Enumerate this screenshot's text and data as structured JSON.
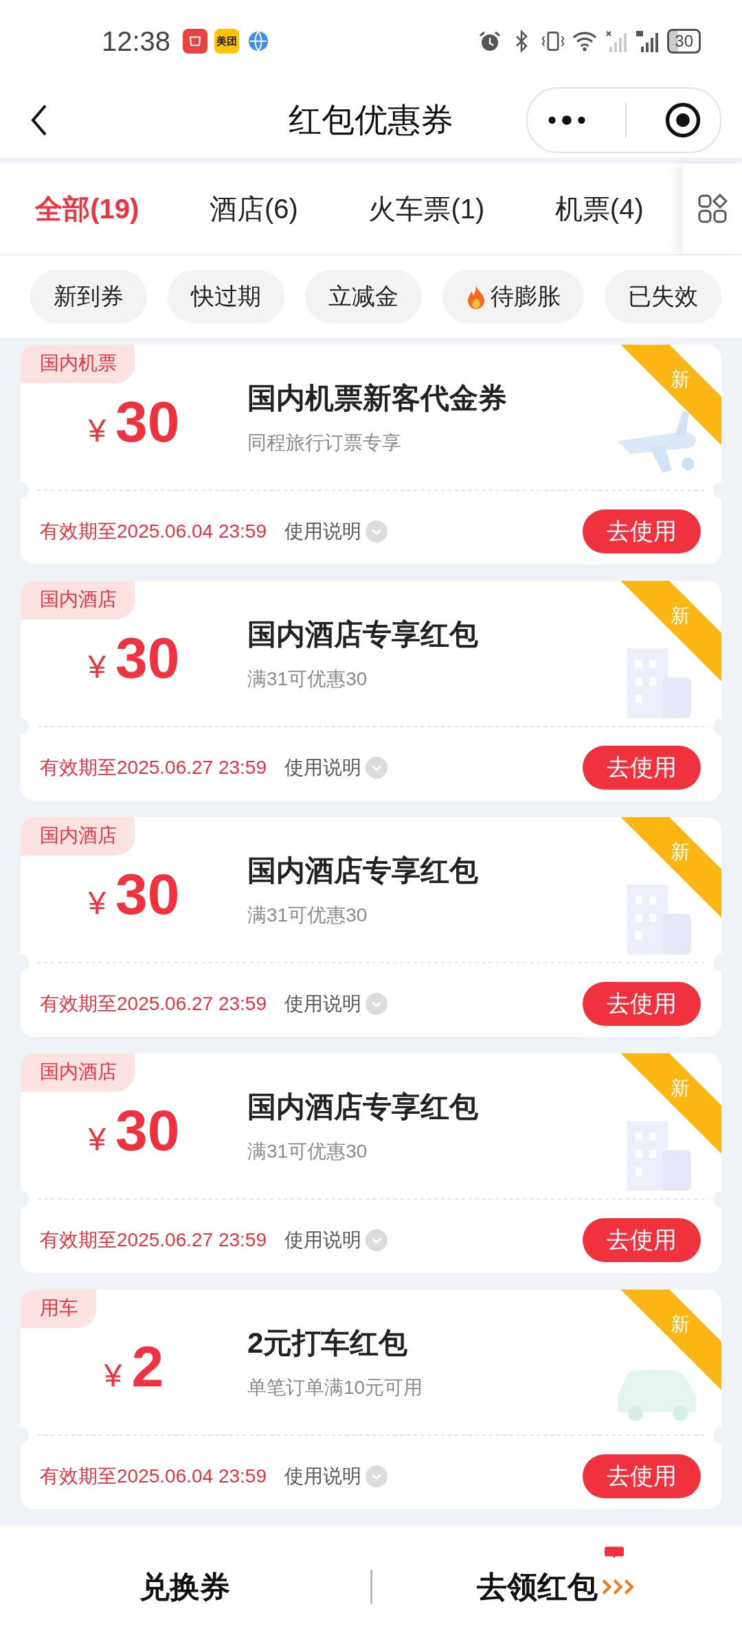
{
  "status_bar": {
    "time": "12:38",
    "meituan_label": "美团",
    "battery": "30"
  },
  "nav": {
    "title": "红包优惠券"
  },
  "tabs": [
    {
      "label": "全部(19)",
      "selected": true
    },
    {
      "label": "酒店(6)",
      "selected": false
    },
    {
      "label": "火车票(1)",
      "selected": false
    },
    {
      "label": "机票(4)",
      "selected": false
    }
  ],
  "filters": [
    {
      "label": "新到券",
      "hot": false
    },
    {
      "label": "快过期",
      "hot": false
    },
    {
      "label": "立减金",
      "hot": false
    },
    {
      "label": "待膨胀",
      "hot": true
    },
    {
      "label": "已失效",
      "hot": false
    }
  ],
  "coupons": [
    {
      "tag": "国内机票",
      "currency": "¥",
      "amount": "30",
      "title": "国内机票新客代金券",
      "subtitle": "同程旅行订票专享",
      "is_new": true,
      "new_label": "新",
      "kind": "plane",
      "expiry": "有效期至2025.06.04 23:59",
      "help": "使用说明",
      "button": "去使用"
    },
    {
      "tag": "国内酒店",
      "currency": "¥",
      "amount": "30",
      "title": "国内酒店专享红包",
      "subtitle": "满31可优惠30",
      "is_new": true,
      "new_label": "新",
      "kind": "building",
      "expiry": "有效期至2025.06.27 23:59",
      "help": "使用说明",
      "button": "去使用"
    },
    {
      "tag": "国内酒店",
      "currency": "¥",
      "amount": "30",
      "title": "国内酒店专享红包",
      "subtitle": "满31可优惠30",
      "is_new": true,
      "new_label": "新",
      "kind": "building",
      "expiry": "有效期至2025.06.27 23:59",
      "help": "使用说明",
      "button": "去使用"
    },
    {
      "tag": "国内酒店",
      "currency": "¥",
      "amount": "30",
      "title": "国内酒店专享红包",
      "subtitle": "满31可优惠30",
      "is_new": true,
      "new_label": "新",
      "kind": "building",
      "expiry": "有效期至2025.06.27 23:59",
      "help": "使用说明",
      "button": "去使用"
    },
    {
      "tag": "用车",
      "currency": "¥",
      "amount": "2",
      "title": "2元打车红包",
      "subtitle": "单笔订单满10元可用",
      "is_new": true,
      "new_label": "新",
      "kind": "car",
      "expiry": "有效期至2025.06.04 23:59",
      "help": "使用说明",
      "button": "去使用"
    }
  ],
  "bottom_bar": {
    "left": "兑换券",
    "right": "去领红包"
  }
}
